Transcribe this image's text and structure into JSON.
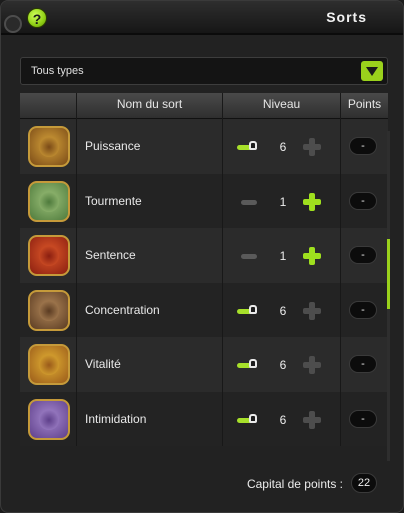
{
  "window": {
    "title": "Sorts"
  },
  "help": {
    "label": "?"
  },
  "filter": {
    "selected": "Tous types"
  },
  "table": {
    "headers": {
      "name": "Nom du sort",
      "level": "Niveau",
      "points": "Points"
    },
    "spells": [
      {
        "name": "Puissance",
        "level": "6",
        "points": "-",
        "minus": "locked",
        "plus": "disabled",
        "colors": [
          "#d7a43b",
          "#7a4a17"
        ]
      },
      {
        "name": "Tourmente",
        "level": "1",
        "points": "-",
        "minus": "disabled",
        "plus": "enabled",
        "colors": [
          "#9ec27a",
          "#4e7a3c"
        ]
      },
      {
        "name": "Sentence",
        "level": "1",
        "points": "-",
        "minus": "disabled",
        "plus": "enabled",
        "colors": [
          "#e05a2a",
          "#8a1e10"
        ]
      },
      {
        "name": "Concentration",
        "level": "6",
        "points": "-",
        "minus": "locked",
        "plus": "disabled",
        "colors": [
          "#b58a5b",
          "#5a3b22"
        ]
      },
      {
        "name": "Vitalité",
        "level": "6",
        "points": "-",
        "minus": "locked",
        "plus": "disabled",
        "colors": [
          "#e3b234",
          "#9a5a1a"
        ]
      },
      {
        "name": "Intimidation",
        "level": "6",
        "points": "-",
        "minus": "locked",
        "plus": "disabled",
        "colors": [
          "#a78ad0",
          "#5e3f8a"
        ]
      }
    ]
  },
  "footer": {
    "capital_label": "Capital de points :",
    "capital_value": "22"
  },
  "colors": {
    "accent": "#9ad11c",
    "background": "#222222"
  }
}
